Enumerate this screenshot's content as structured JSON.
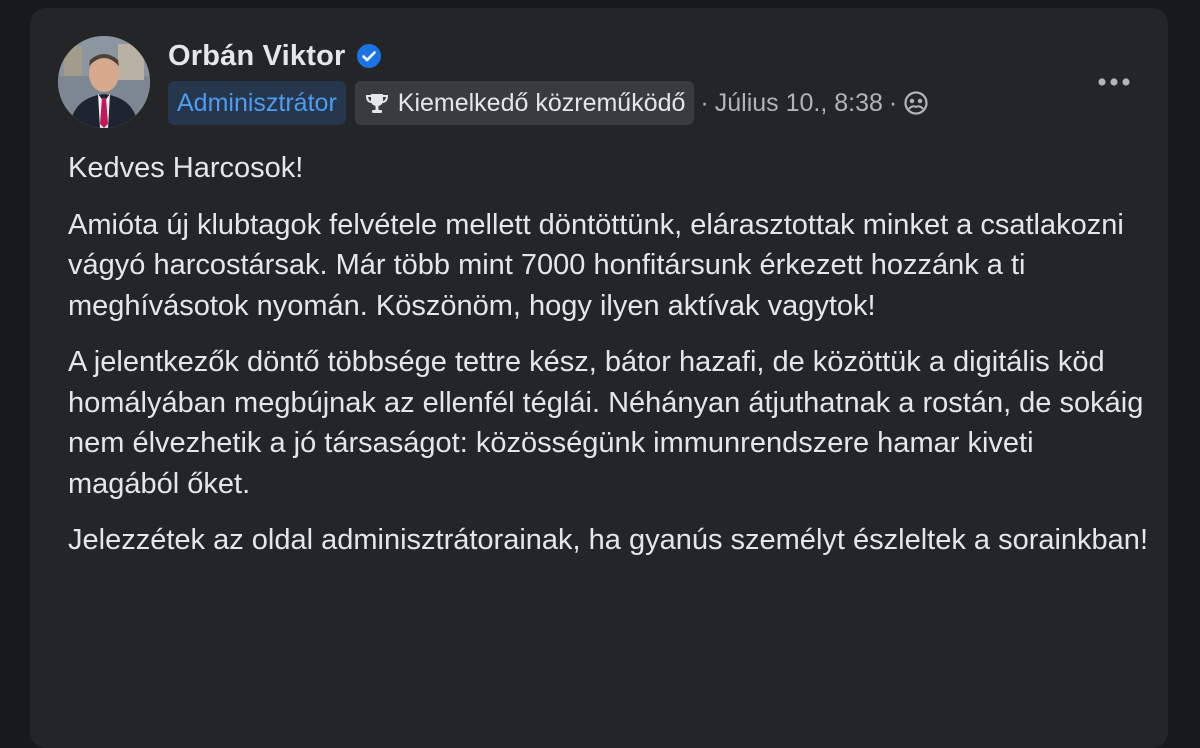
{
  "post": {
    "author": {
      "name": "Orbán Viktor",
      "verified": true,
      "avatar": "profile-photo"
    },
    "badges": {
      "admin": "Adminisztrátor",
      "contributor": "Kiemelkedő közreműködő"
    },
    "meta": {
      "separator": "·",
      "date": "Július 10., 8:38",
      "audience_icon": "group-audience-icon"
    },
    "more_icon": "more-options-icon",
    "paragraphs": [
      "Kedves Harcosok!",
      "Amióta új klubtagok felvétele mellett döntöttünk, elárasztottak minket a csatlakozni vágyó harcostársak. Már több mint 7000 honfitársunk érkezett hozzánk a ti meghívásotok nyomán. Köszönöm, hogy ilyen aktívak vagytok!",
      "A jelentkezők döntő többsége tettre kész, bátor hazafi, de közöttük a digitális köd homályában megbújnak az ellenfél téglái. Néhányan átjuthatnak a rostán, de sokáig nem élvezhetik a jó társaságot: közösségünk immunrendszere hamar kiveti magából őket.",
      "Jelezzétek az oldal adminisztrátorainak, ha gyanús személyt észleltek a sorainkban!"
    ]
  },
  "colors": {
    "page_background": "#18191a",
    "card_background": "#242526",
    "primary_text": "#e4e6eb",
    "secondary_text": "#b0b3b8",
    "admin_badge_text": "#4d9cf0",
    "verified_blue": "#1b74e4"
  }
}
